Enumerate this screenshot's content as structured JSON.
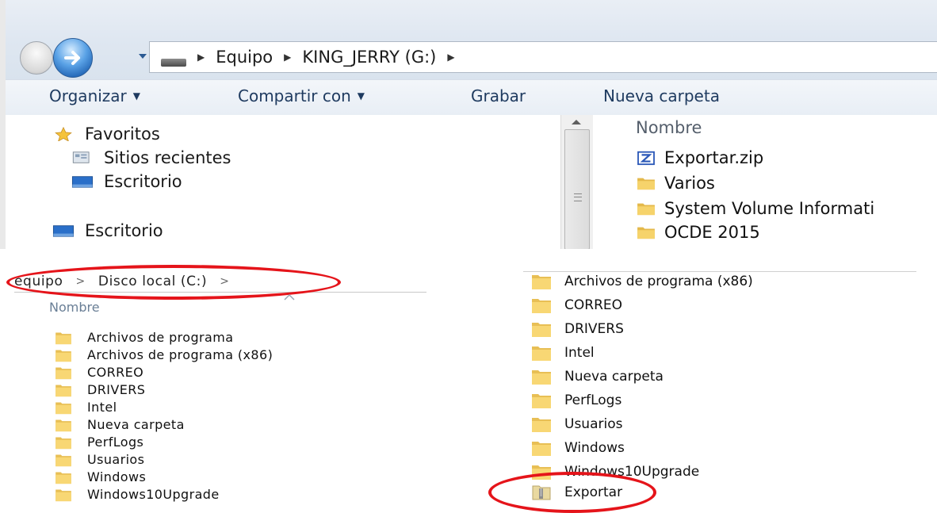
{
  "top_window": {
    "breadcrumb": [
      "Equipo",
      "KING_JERRY (G:)"
    ],
    "toolbar": {
      "organize": "Organizar",
      "share": "Compartir con",
      "burn": "Grabar",
      "new_folder": "Nueva carpeta"
    },
    "nav_pane": {
      "favorites": "Favoritos",
      "recent": "Sitios recientes",
      "desktop_fav": "Escritorio",
      "desktop": "Escritorio"
    },
    "content": {
      "column_name": "Nombre",
      "files": [
        {
          "name": "Exportar.zip",
          "icon": "zip-icon"
        },
        {
          "name": "Varios",
          "icon": "folder-icon"
        },
        {
          "name": "System Volume Informati",
          "icon": "folder-icon"
        },
        {
          "name": "OCDE 2015",
          "icon": "folder-icon"
        }
      ]
    }
  },
  "bottom_left": {
    "breadcrumb": [
      "equipo",
      "Disco local (C:)"
    ],
    "column_name": "Nombre",
    "folders": [
      "Archivos de programa",
      "Archivos de programa (x86)",
      "CORREO",
      "DRIVERS",
      "Intel",
      "Nueva carpeta",
      "PerfLogs",
      "Usuarios",
      "Windows",
      "Windows10Upgrade"
    ]
  },
  "bottom_right": {
    "folders": [
      "Archivos de programa (x86)",
      "CORREO",
      "DRIVERS",
      "Intel",
      "Nueva carpeta",
      "PerfLogs",
      "Usuarios",
      "Windows",
      "Windows10Upgrade"
    ],
    "highlighted_item": {
      "name": "Exportar",
      "icon": "zipped-folder-icon"
    }
  },
  "colors": {
    "highlight_ellipse": "#e5141a",
    "folder_yellow": "#f6d36b",
    "toolbar_text": "#1e3a5f"
  }
}
